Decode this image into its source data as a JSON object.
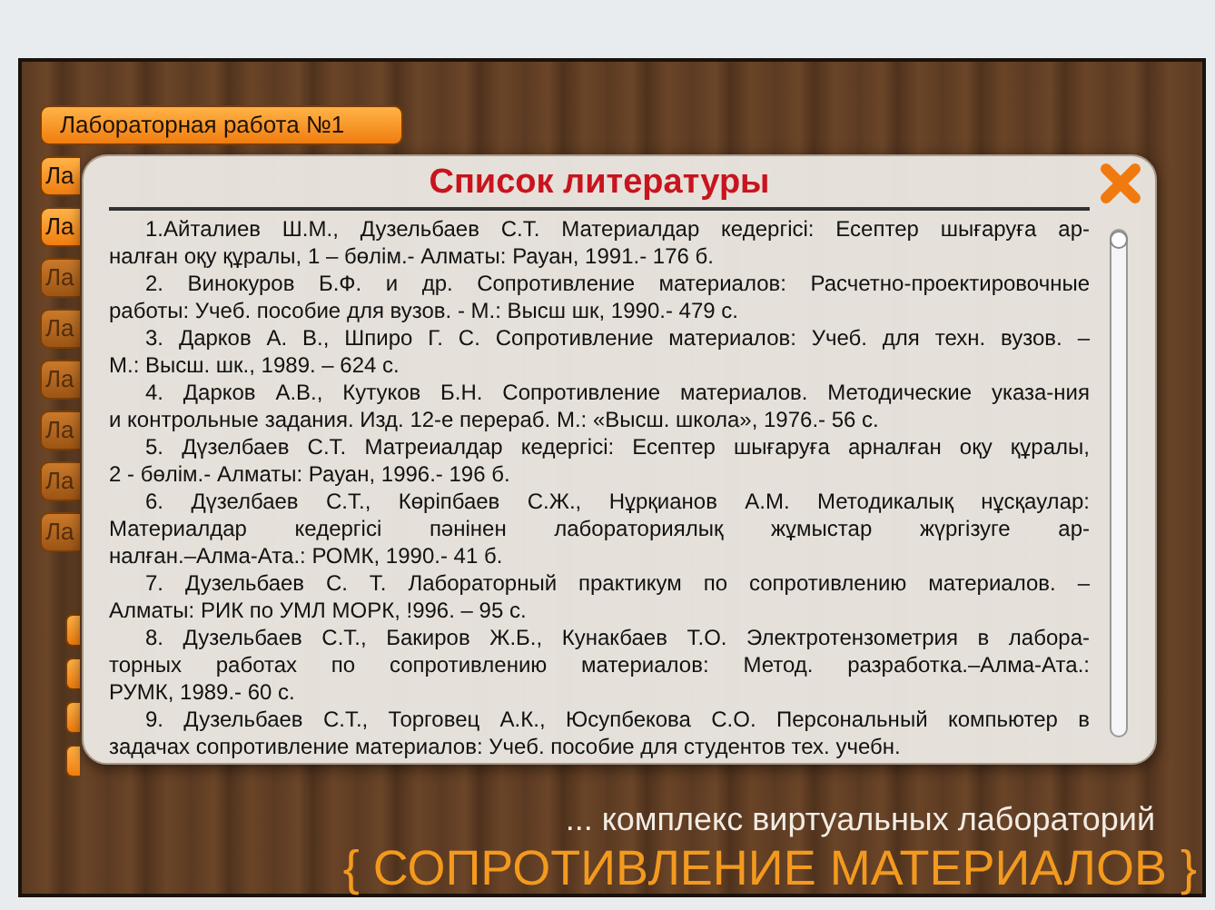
{
  "sidebar": {
    "items": [
      {
        "kind": "tab",
        "label": "Лабораторная работа №1",
        "disabled": false
      },
      {
        "kind": "partial",
        "label": "Ла",
        "disabled": false
      },
      {
        "kind": "partial",
        "label": "Ла",
        "disabled": false
      },
      {
        "kind": "partial",
        "label": "Ла",
        "disabled": true
      },
      {
        "kind": "partial",
        "label": "Ла",
        "disabled": true
      },
      {
        "kind": "partial",
        "label": "Ла",
        "disabled": true
      },
      {
        "kind": "partial",
        "label": "Ла",
        "disabled": true
      },
      {
        "kind": "partial",
        "label": "Ла",
        "disabled": true
      },
      {
        "kind": "partial",
        "label": "Ла",
        "disabled": true
      },
      {
        "kind": "small"
      },
      {
        "kind": "small"
      },
      {
        "kind": "small"
      },
      {
        "kind": "small"
      }
    ]
  },
  "dialog": {
    "title": "Список литературы",
    "references": [
      {
        "lines": [
          "1.Айталиев Ш.М., Дузельбаев С.Т. Материалдар кедергісі: Есептер шығаруға ар-",
          "налған оқу құралы, 1 – бөлім.- Алматы: Рауан, 1991.- 176  б."
        ]
      },
      {
        "lines": [
          "2. Винокуров Б.Ф. и др. Сопротивление материалов: Расчетно-проектировочные",
          "работы: Учеб. пособие для вузов. - М.: Высш шк, 1990.- 479 с."
        ]
      },
      {
        "lines": [
          "3. Дарков А. В., Шпиро Г. С. Сопротивление материалов: Учеб. для техн. вузов. –",
          "М.: Высш. шк., 1989. – 624 с."
        ]
      },
      {
        "lines": [
          "4. Дарков А.В., Кутуков Б.Н. Сопротивление материалов. Методические указа-ния",
          "и контрольные задания. Изд. 12-е перераб. М.: «Высш. школа», 1976.- 56 с."
        ]
      },
      {
        "lines": [
          "5. Дүзелбаев С.Т. Матреиалдар кедергісі: Есептер шығаруға арналған оқу құралы,",
          "2 - бөлім.- Алматы: Рауан, 1996.- 196  б."
        ]
      },
      {
        "lines": [
          "6. Дүзелбаев С.Т., Көріпбаев С.Ж., Нұрқианов А.М. Методикалық нұсқаулар:",
          "Материалдар кедергісі пәнінен лабораториялық жұмыстар жүргізуге ар-",
          "налған.–Алма-Ата.: РОМК, 1990.- 41 б."
        ]
      },
      {
        "lines": [
          "7. Дузельбаев С. Т. Лабораторный практикум по сопротивлению материалов. –",
          "Алматы: РИК по УМЛ МОРК, !996. – 95 с."
        ]
      },
      {
        "lines": [
          "8. Дузельбаев С.Т., Бакиров Ж.Б., Кунакбаев Т.О. Электротензометрия в лабора-",
          "торных работах по сопротивлению материалов: Метод. разработка.–Алма-Ата.:",
          "РУМК, 1989.- 60 с."
        ]
      },
      {
        "lines": [
          "9. Дузельбаев С.Т., Торговец А.К., Юсупбекова С.О. Персональный компьютер в",
          "задачах сопротивление материалов: Учеб. пособие для студентов тех. учебн."
        ]
      }
    ]
  },
  "footer": {
    "subtitle": "... комплекс виртуальных лабораторий",
    "title": "{ СОПРОТИВЛЕНИЕ МАТЕРИАЛОВ }"
  }
}
